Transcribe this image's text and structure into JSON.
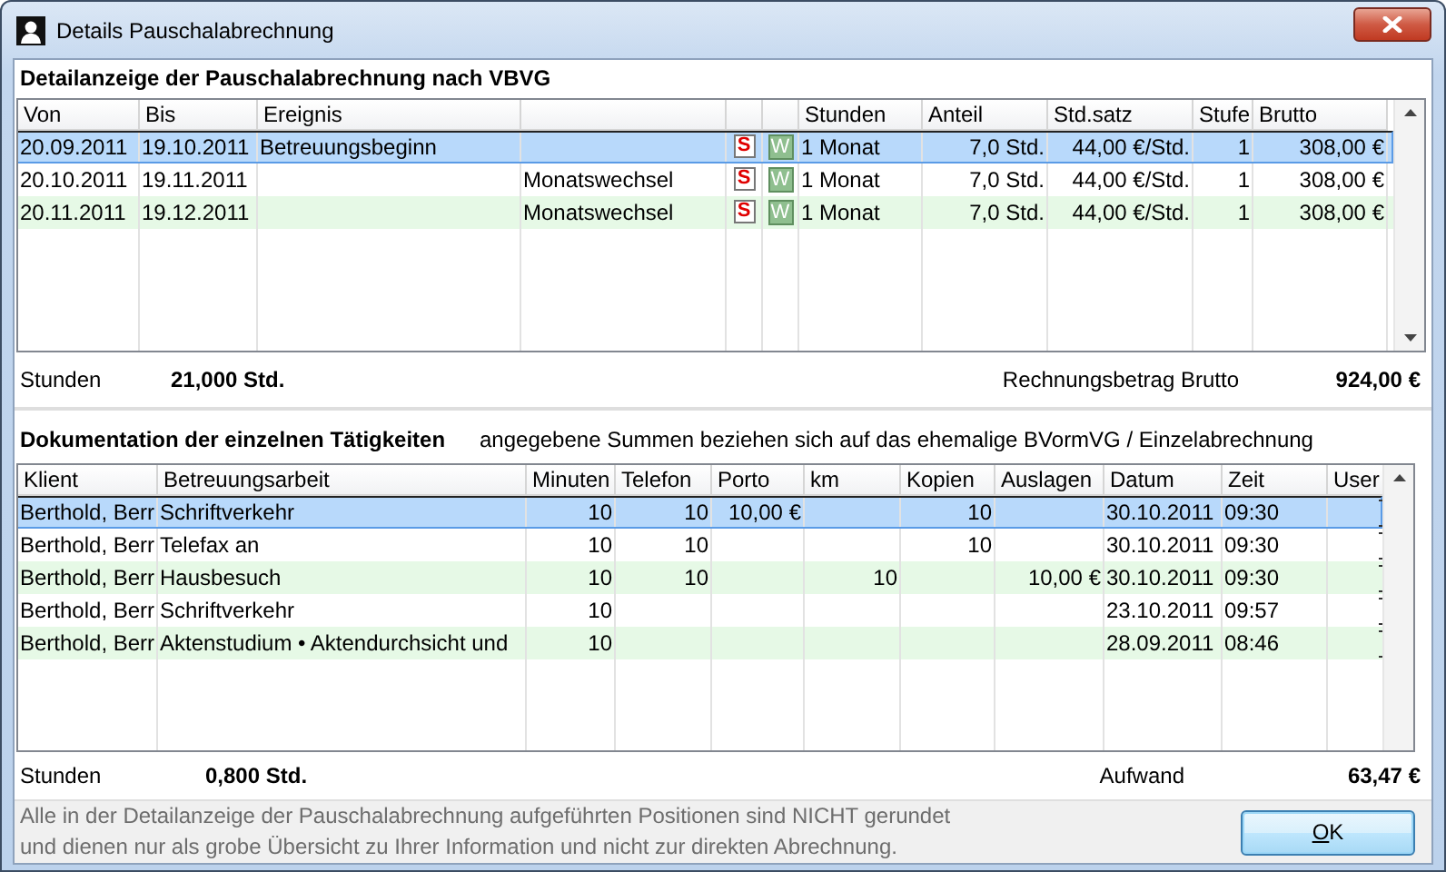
{
  "window": {
    "title": "Details Pauschalabrechnung"
  },
  "billing": {
    "heading": "Detailanzeige der Pauschalabrechnung nach VBVG",
    "table": {
      "columns": [
        "Von",
        "Bis",
        "Ereignis",
        null,
        null,
        null,
        "Stunden",
        "Anteil",
        "Std.satz",
        "Stufe",
        "Brutto"
      ],
      "rows": [
        {
          "selected": true,
          "cells": [
            "20.09.2011",
            "19.10.2011",
            "Betreuungsbeginn",
            null,
            "S",
            "W",
            "1 Monat",
            "7,0 Std.",
            "44,00 €/Std.",
            "1",
            "308,00 €"
          ]
        },
        {
          "selected": false,
          "cells": [
            "20.10.2011",
            "19.11.2011",
            null,
            "Monatswechsel",
            "S",
            "W",
            "1 Monat",
            "7,0 Std.",
            "44,00 €/Std.",
            "1",
            "308,00 €"
          ]
        },
        {
          "selected": false,
          "cells": [
            "20.11.2011",
            "19.12.2011",
            null,
            "Monatswechsel",
            "S",
            "W",
            "1 Monat",
            "7,0 Std.",
            "44,00 €/Std.",
            "1",
            "308,00 €"
          ]
        }
      ]
    },
    "summary": {
      "hours_label": "Stunden",
      "hours": "21,000 Std.",
      "total_label": "Rechnungsbetrag Brutto",
      "total": "924,00 €"
    }
  },
  "activities": {
    "heading": "Dokumentation der einzelnen Tätigkeiten",
    "note": "angegebene Summen beziehen sich auf das ehemalige BVormVG / Einzelabrechnung",
    "table": {
      "columns": [
        "Klient",
        "Betreuungsarbeit",
        "Minuten",
        "Telefon",
        "Porto",
        "km",
        "Kopien",
        "Auslagen",
        "Datum",
        "Zeit",
        "User"
      ],
      "rows": [
        {
          "selected": true,
          "cells": [
            "Berthold, Berr",
            "Schriftverkehr",
            "10",
            "10",
            "10,00 €",
            null,
            "10",
            null,
            "30.10.2011",
            "09:30",
            null
          ]
        },
        {
          "selected": false,
          "cells": [
            "Berthold, Berr",
            "Telefax an",
            "10",
            "10",
            null,
            null,
            "10",
            null,
            "30.10.2011",
            "09:30",
            null
          ]
        },
        {
          "selected": false,
          "cells": [
            "Berthold, Berr",
            "Hausbesuch",
            "10",
            "10",
            null,
            "10",
            null,
            "10,00 €",
            "30.10.2011",
            "09:30",
            null
          ]
        },
        {
          "selected": false,
          "cells": [
            "Berthold, Berr",
            "Schriftverkehr",
            "10",
            null,
            null,
            null,
            null,
            null,
            "23.10.2011",
            "09:57",
            null
          ]
        },
        {
          "selected": false,
          "cells": [
            "Berthold, Berr",
            "Aktenstudium • Aktendurchsicht und",
            "10",
            null,
            null,
            null,
            null,
            null,
            "28.09.2011",
            "08:46",
            null
          ]
        }
      ]
    },
    "summary": {
      "hours_label": "Stunden",
      "hours": "0,800 Std.",
      "total_label": "Aufwand",
      "total": "63,47 €"
    }
  },
  "footer": {
    "note_lines": [
      "Alle in der Detailanzeige der Pauschalabrechnung aufgeführten Positionen sind NICHT gerundet",
      "und dienen nur als grobe Übersicht zu Ihrer Information und nicht zur direkten Abrechnung."
    ],
    "ok_button": "OK"
  }
}
